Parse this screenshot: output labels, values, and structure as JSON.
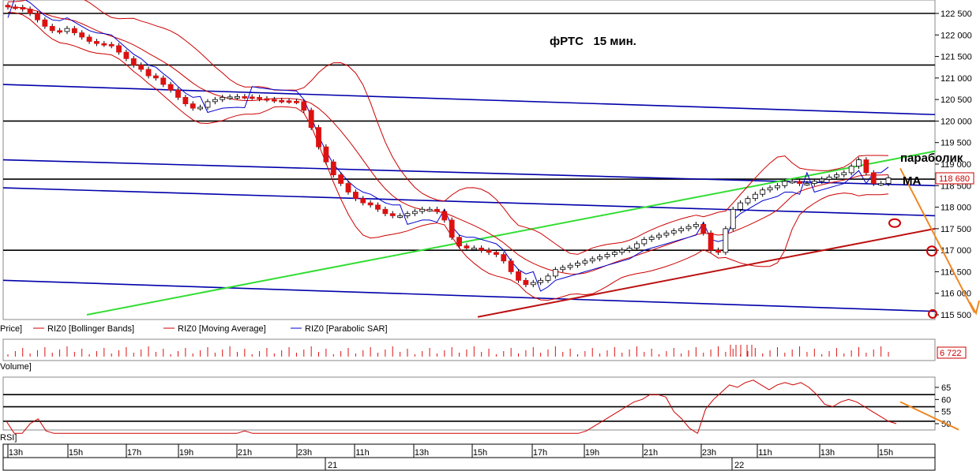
{
  "title": "фРТС   15 мин.",
  "annotations": {
    "parabolic": "параболик",
    "ma": "МА"
  },
  "price_panel": {
    "last_price": "118 680",
    "legend": [
      {
        "label": "Price]",
        "color": "#000000"
      },
      {
        "label": "RIZ0 [Bollinger Bands]",
        "color": "#cc0000"
      },
      {
        "label": "RIZ0 [Moving Average]",
        "color": "#cc0000"
      },
      {
        "label": "RIZ0 [Parabolic SAR]",
        "color": "#0000cc"
      }
    ]
  },
  "volume_panel": {
    "label": "Volume]",
    "last_volume": "6 722"
  },
  "rsi_panel": {
    "label": "RSI]"
  },
  "colors": {
    "grid": "#000000",
    "candle_up": "#ffffff",
    "candle_down": "#dd1111",
    "bollinger": "#cc0000",
    "sar": "#0000cc",
    "levels": "#0000aa",
    "green_trend": "#33dd33",
    "red_trend": "#bb1111",
    "forecast": "#ee8822"
  },
  "chart_data": [
    {
      "type": "candlestick",
      "title": "фРТС   15 мин.",
      "y_ticks": [
        "122 500",
        "122 000",
        "121 500",
        "121 000",
        "120 500",
        "120 000",
        "119 500",
        "119 000",
        "118 500",
        "118 000",
        "117 500",
        "117 000",
        "116 500",
        "116 000",
        "115 500"
      ],
      "ylim": [
        115400,
        122800
      ],
      "grid_levels": [
        122500,
        121300,
        120000,
        118650,
        117000
      ],
      "x_ticks": [
        "13h",
        "15h",
        "17h",
        "19h",
        "21h",
        "23h",
        "11h",
        "13h",
        "15h",
        "17h",
        "19h",
        "21h",
        "23h",
        "11h",
        "13h",
        "15h"
      ],
      "day_labels": [
        "21",
        "22"
      ],
      "close": [
        122650,
        122640,
        122600,
        122500,
        122350,
        122200,
        122100,
        122080,
        122150,
        122050,
        121950,
        121850,
        121800,
        121780,
        121750,
        121600,
        121450,
        121300,
        121200,
        121050,
        121000,
        120850,
        120720,
        120550,
        120400,
        120300,
        120320,
        120450,
        120500,
        120550,
        120560,
        120570,
        120560,
        120550,
        120520,
        120500,
        120480,
        120470,
        120460,
        120450,
        120250,
        119850,
        119400,
        119050,
        118750,
        118550,
        118350,
        118200,
        118100,
        118050,
        117950,
        117850,
        117800,
        117800,
        117850,
        117900,
        117950,
        117950,
        117900,
        117700,
        117300,
        117100,
        117050,
        117050,
        117000,
        116950,
        116900,
        116750,
        116500,
        116300,
        116200,
        116250,
        116300,
        116400,
        116550,
        116600,
        116650,
        116700,
        116750,
        116800,
        116850,
        116900,
        116950,
        117000,
        117050,
        117150,
        117250,
        117300,
        117350,
        117400,
        117450,
        117500,
        117550,
        117600,
        117400,
        117000,
        116950,
        117500,
        117950,
        118100,
        118200,
        118300,
        118400,
        118450,
        118500,
        118600,
        118600,
        118550,
        118550,
        118600,
        118650,
        118700,
        118750,
        118800,
        118950,
        119100,
        118800,
        118550,
        118550,
        118680
      ],
      "series": [
        {
          "name": "RIZ0 [Bollinger Bands]",
          "kind": "band"
        },
        {
          "name": "RIZ0 [Moving Average]",
          "kind": "line"
        },
        {
          "name": "RIZ0 [Parabolic SAR]",
          "kind": "dots"
        }
      ]
    },
    {
      "type": "bar",
      "title": "Volume",
      "last_value": "6 722"
    },
    {
      "type": "line",
      "title": "RSI",
      "y_ticks": [
        "65",
        "60",
        "55",
        "50"
      ],
      "ylim": [
        46,
        68
      ],
      "levels": [
        62,
        57,
        51
      ],
      "values": [
        51,
        44,
        46,
        50,
        52,
        47,
        45,
        44,
        46,
        45,
        42,
        41,
        43,
        42,
        40,
        39,
        38,
        37,
        36,
        38,
        37,
        36,
        35,
        34,
        33,
        34,
        36,
        40,
        43,
        45,
        47,
        46,
        44,
        41,
        38,
        36,
        33,
        31,
        30,
        29,
        28,
        27,
        29,
        31,
        34,
        36,
        38,
        40,
        41,
        43,
        44,
        45,
        45,
        44,
        43,
        42,
        41,
        40,
        39,
        38,
        37,
        36,
        36,
        37,
        38,
        39,
        40,
        41,
        42,
        40,
        41,
        43,
        45,
        47,
        49,
        51,
        53,
        55,
        57,
        59,
        60,
        62,
        62,
        61,
        55,
        52,
        48,
        45,
        56,
        60,
        63,
        66,
        65,
        67,
        68,
        66,
        64,
        66,
        67,
        66,
        67,
        65,
        62,
        58,
        57,
        59,
        60,
        59,
        57,
        55,
        53,
        51,
        50
      ]
    }
  ]
}
